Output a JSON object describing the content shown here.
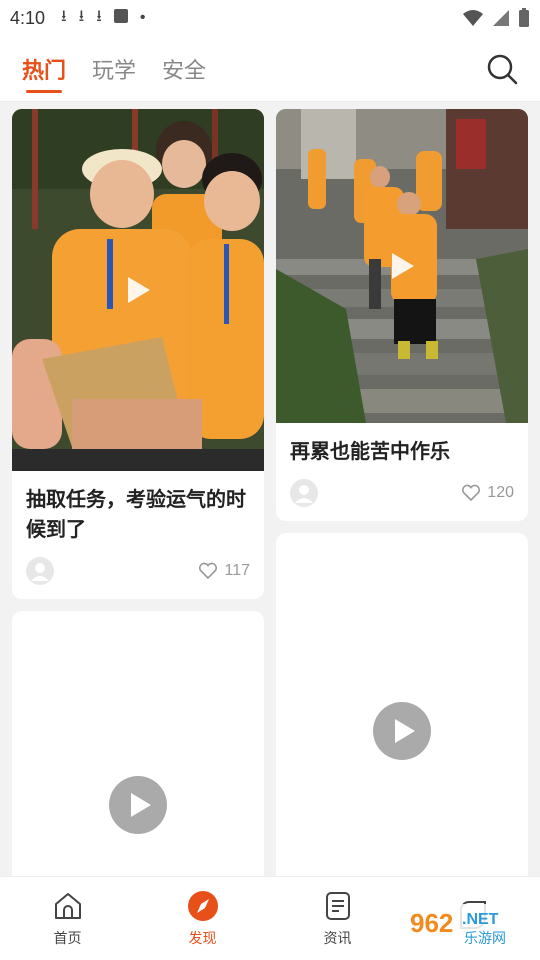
{
  "status_bar": {
    "time": "4:10"
  },
  "tabs": [
    {
      "label": "热门",
      "active": true
    },
    {
      "label": "玩学",
      "active": false
    },
    {
      "label": "安全",
      "active": false
    }
  ],
  "cards": {
    "left": [
      {
        "title": "抽取任务，考验运气的时候到了",
        "likes": "117"
      }
    ],
    "right": [
      {
        "title": "再累也能苦中作乐",
        "likes": "120"
      }
    ]
  },
  "bottom_nav": [
    {
      "label": "首页",
      "icon": "home-icon",
      "active": false
    },
    {
      "label": "发现",
      "icon": "compass-icon",
      "active": true
    },
    {
      "label": "资讯",
      "icon": "document-icon",
      "active": false
    },
    {
      "label": "",
      "icon": "leaf-icon",
      "active": false
    }
  ],
  "watermark": {
    "text1": "962",
    "text2": ".NET",
    "text3": "乐游网"
  },
  "colors": {
    "accent": "#e8501a",
    "background": "#f2f2f2",
    "card": "#ffffff"
  }
}
